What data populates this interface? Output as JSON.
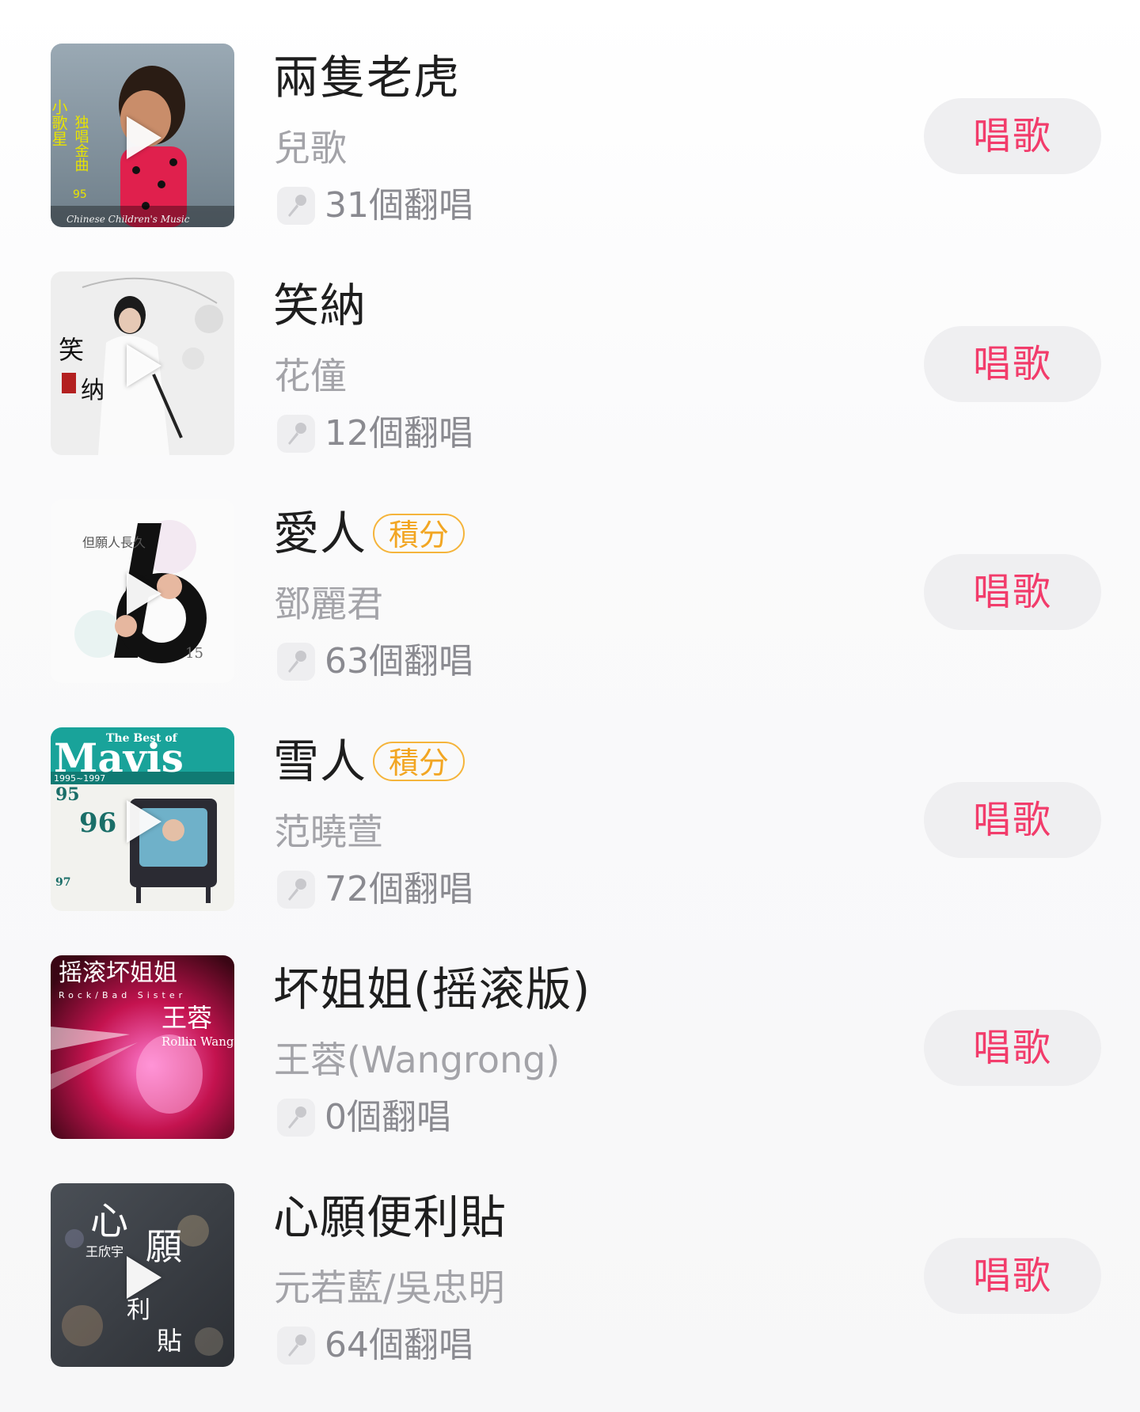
{
  "songs": [
    {
      "title": "兩隻老虎",
      "artist": "兒歌",
      "covers": "31個翻唱",
      "tag": "",
      "button": "唱歌",
      "art_text": [
        "小歌星",
        "独唱金曲",
        "95",
        "Chinese Children's Music"
      ]
    },
    {
      "title": "笑納",
      "artist": "花僮",
      "covers": "12個翻唱",
      "tag": "",
      "button": "唱歌",
      "art_text": [
        "笑",
        "纳"
      ]
    },
    {
      "title": "愛人",
      "artist": "鄧麗君",
      "covers": "63個翻唱",
      "tag": "積分",
      "button": "唱歌",
      "art_text": [
        "但願人長久",
        "15"
      ]
    },
    {
      "title": "雪人",
      "artist": "范曉萱",
      "covers": "72個翻唱",
      "tag": "積分",
      "button": "唱歌",
      "art_text": [
        "The Best of",
        "Mavis",
        "1995~1997",
        "95",
        "96",
        "97"
      ]
    },
    {
      "title": "坏姐姐(摇滚版)",
      "artist": "王蓉(Wangrong)",
      "covers": "0個翻唱",
      "tag": "",
      "button": "唱歌",
      "art_text": [
        "摇滚坏姐姐",
        "Rock/Bad Sister",
        "王蓉",
        "Rollin Wang"
      ]
    },
    {
      "title": "心願便利貼",
      "artist": "元若藍/吳忠明",
      "covers": "64個翻唱",
      "tag": "",
      "button": "唱歌",
      "art_text": [
        "心",
        "願",
        "王欣宇",
        "利",
        "貼"
      ]
    }
  ],
  "colors": {
    "accent": "#f23c6b",
    "tag": "#f2a623",
    "button_bg": "#efeff1"
  },
  "icons": {
    "play": "play-icon",
    "mic": "microphone-icon"
  }
}
